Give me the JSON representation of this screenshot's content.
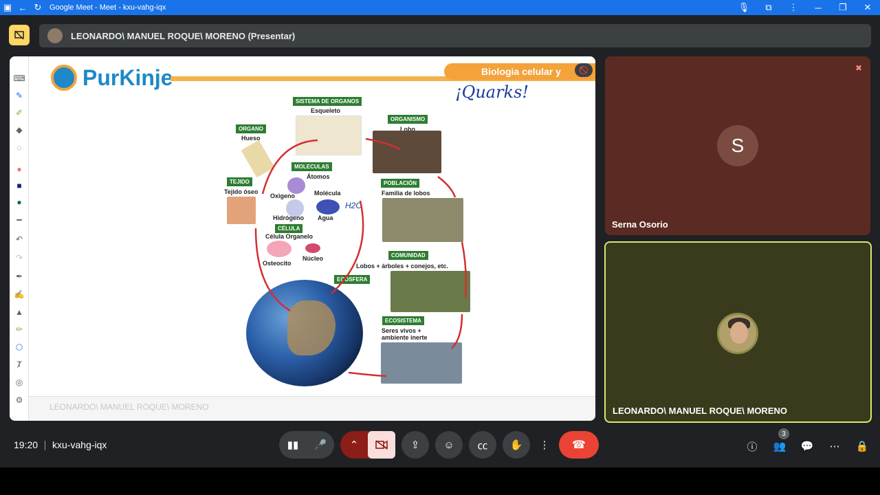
{
  "window": {
    "title": "Google Meet - Meet - kxu-vahg-iqx",
    "accent": "#1a73e8"
  },
  "presenter_bar": {
    "name": "LEONARDO\\ MANUEL ROQUE\\ MORENO (Presentar)"
  },
  "slide": {
    "logo_text": "PurKinje",
    "banner": "Biologia celular y",
    "handwritten": "¡Quarks!",
    "labels": {
      "sistema_organos": "SISTEMA DE ORGANOS",
      "esqueleto": "Esqueleto",
      "organismo": "ORGANISMO",
      "lobo": "Lobo",
      "organo": "ORGANO",
      "hueso": "Hueso",
      "moleculas": "MOLECULAS",
      "atomos": "Átomos",
      "tejido": "TEJIDO",
      "tejido_oseo": "Tejido óseo",
      "oxigeno": "Oxigeno",
      "molecula": "Molécula",
      "hidrogeno": "Hidrógeno",
      "agua": "Agua",
      "h2o": "H2O",
      "poblacion": "POBLACIÓN",
      "familia": "Familia de lobos",
      "celula": "CÉLULA",
      "celula_organelo": "Célula Organelo",
      "osteocito": "Osteocito",
      "nucleo": "Núcleo",
      "comunidad": "COMUNIDAD",
      "lobos_arboles": "Lobos + árboles + conejos, etc.",
      "ecosfera": "ECOSFERA",
      "ecosistema": "ECOSISTEMA",
      "seres_vivos": "Seres vivos +",
      "ambiente": "ambiente inerte"
    },
    "footer_name": "LEONARDO\\ MANUEL ROQUE\\ MORENO"
  },
  "participants": [
    {
      "name": "Serna Osorio",
      "initial": "S",
      "muted": true,
      "tile_color": "#5b2a22"
    },
    {
      "name": "LEONARDO\\ MANUEL ROQUE\\ MORENO",
      "speaking": true
    }
  ],
  "bottom_bar": {
    "time": "19:20",
    "meeting_code": "kxu-vahg-iqx",
    "participant_count": "3"
  }
}
